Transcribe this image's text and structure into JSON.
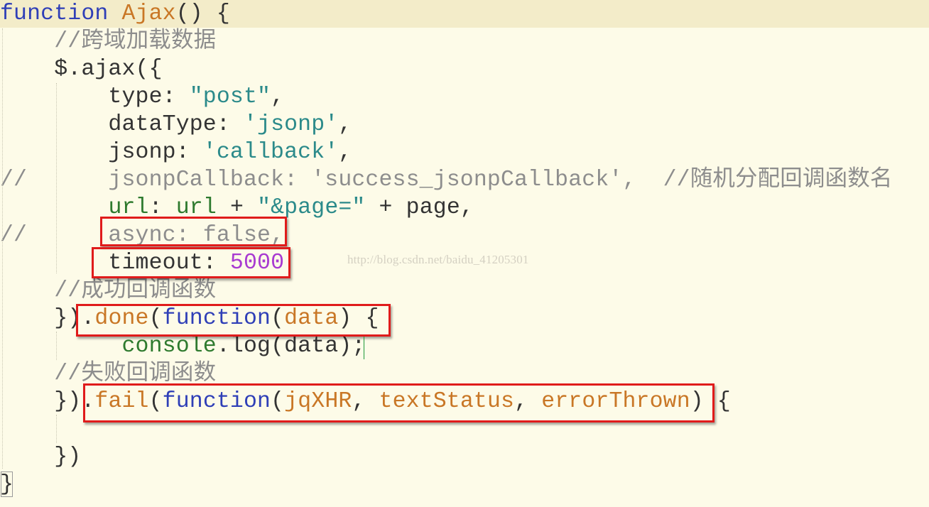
{
  "editor": {
    "lines": [
      {
        "id": "l1",
        "tokens": [
          {
            "t": "function",
            "c": "kw"
          },
          {
            "t": " ",
            "c": "plain"
          },
          {
            "t": "Ajax",
            "c": "fn"
          },
          {
            "t": "() {",
            "c": "plain"
          }
        ]
      },
      {
        "id": "l2",
        "tokens": [
          {
            "t": "    //跨域加载数据",
            "c": "com"
          }
        ]
      },
      {
        "id": "l3",
        "tokens": [
          {
            "t": "    $.ajax({",
            "c": "plain"
          }
        ]
      },
      {
        "id": "l4",
        "tokens": [
          {
            "t": "        type: ",
            "c": "plain"
          },
          {
            "t": "\"post\"",
            "c": "str"
          },
          {
            "t": ",",
            "c": "plain"
          }
        ]
      },
      {
        "id": "l5",
        "tokens": [
          {
            "t": "        dataType: ",
            "c": "plain"
          },
          {
            "t": "'jsonp'",
            "c": "str"
          },
          {
            "t": ",",
            "c": "plain"
          }
        ]
      },
      {
        "id": "l6",
        "tokens": [
          {
            "t": "        jsonp: ",
            "c": "plain"
          },
          {
            "t": "'callback'",
            "c": "str"
          },
          {
            "t": ",",
            "c": "plain"
          }
        ]
      },
      {
        "id": "l7",
        "tokens": [
          {
            "t": "//      jsonpCallback: 'success_jsonpCallback',  //随机分配回调函数名",
            "c": "com"
          }
        ]
      },
      {
        "id": "l8",
        "tokens": [
          {
            "t": "        ",
            "c": "plain"
          },
          {
            "t": "url",
            "c": "ident"
          },
          {
            "t": ": ",
            "c": "plain"
          },
          {
            "t": "url",
            "c": "ident"
          },
          {
            "t": " + ",
            "c": "plain"
          },
          {
            "t": "\"&page=\"",
            "c": "str"
          },
          {
            "t": " + page,",
            "c": "plain"
          }
        ]
      },
      {
        "id": "l9",
        "tokens": [
          {
            "t": "//      async: false,",
            "c": "com"
          }
        ]
      },
      {
        "id": "l10",
        "tokens": [
          {
            "t": "        timeout: ",
            "c": "plain"
          },
          {
            "t": "5000",
            "c": "num"
          }
        ]
      },
      {
        "id": "l11",
        "tokens": [
          {
            "t": "    //成功回调函数",
            "c": "com"
          }
        ]
      },
      {
        "id": "l12",
        "tokens": [
          {
            "t": "    })",
            "c": "plain"
          },
          {
            "t": ".",
            "c": "plain"
          },
          {
            "t": "done",
            "c": "fn"
          },
          {
            "t": "(",
            "c": "plain"
          },
          {
            "t": "function",
            "c": "kw"
          },
          {
            "t": "(",
            "c": "plain"
          },
          {
            "t": "data",
            "c": "fn"
          },
          {
            "t": ") {",
            "c": "plain"
          }
        ]
      },
      {
        "id": "l13",
        "tokens": [
          {
            "t": "         ",
            "c": "plain"
          },
          {
            "t": "console",
            "c": "ident"
          },
          {
            "t": ".log(data);",
            "c": "plain"
          }
        ]
      },
      {
        "id": "l14",
        "tokens": [
          {
            "t": "    //失败回调函数",
            "c": "com"
          }
        ]
      },
      {
        "id": "l15",
        "tokens": [
          {
            "t": "    })",
            "c": "plain"
          },
          {
            "t": ".",
            "c": "plain"
          },
          {
            "t": "fail",
            "c": "fn"
          },
          {
            "t": "(",
            "c": "plain"
          },
          {
            "t": "function",
            "c": "kw"
          },
          {
            "t": "(",
            "c": "plain"
          },
          {
            "t": "jqXHR",
            "c": "fn"
          },
          {
            "t": ", ",
            "c": "plain"
          },
          {
            "t": "textStatus",
            "c": "fn"
          },
          {
            "t": ", ",
            "c": "plain"
          },
          {
            "t": "errorThrown",
            "c": "fn"
          },
          {
            "t": ") {",
            "c": "plain"
          }
        ]
      },
      {
        "id": "l16",
        "tokens": [
          {
            "t": "",
            "c": "plain"
          }
        ]
      },
      {
        "id": "l17",
        "tokens": [
          {
            "t": "    })",
            "c": "plain"
          }
        ]
      },
      {
        "id": "l18",
        "tokens": [
          {
            "t": "}",
            "c": "plain"
          }
        ]
      }
    ]
  },
  "watermark": "http://blog.csdn.net/baidu_41205301",
  "colors": {
    "background": "#fdfbe8",
    "current_line": "#f3ecc9",
    "keyword": "#2f3fb7",
    "function_name": "#c97726",
    "string": "#2b8a8a",
    "number": "#a83ad1",
    "comment": "#8d8d8d",
    "highlight_box": "#e01b1b"
  }
}
